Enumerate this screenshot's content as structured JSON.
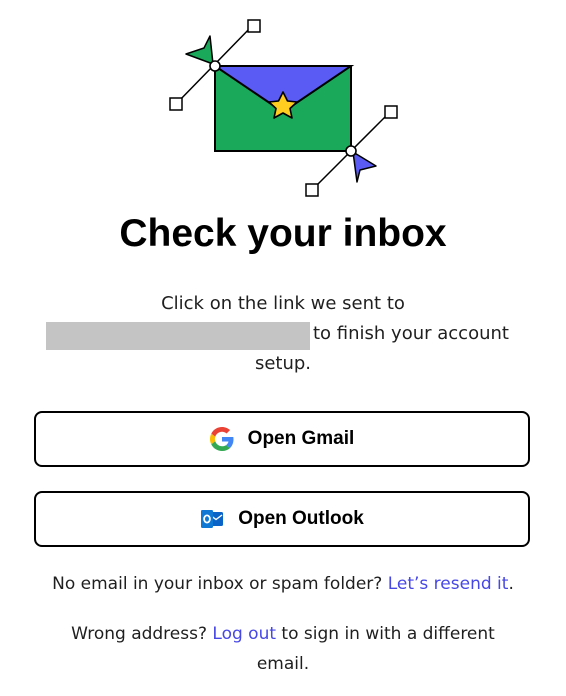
{
  "page": {
    "title": "Check your inbox"
  },
  "message": {
    "line1": "Click on the link we sent to",
    "line2_suffix": "to finish your account",
    "line3": "setup."
  },
  "buttons": {
    "gmail_label": "Open Gmail",
    "outlook_label": "Open Outlook"
  },
  "resend": {
    "prefix": "No email in your inbox or spam folder?",
    "link": "Let’s resend it",
    "suffix": "."
  },
  "wrong_address": {
    "prefix": "Wrong address?",
    "link": "Log out",
    "suffix_line1": "to sign in with a different",
    "suffix_line2": "email."
  },
  "colors": {
    "envelope_green": "#1aa85a",
    "flap_blue": "#5a5af5",
    "star_yellow": "#ffcd1f",
    "link_blue": "#4747e6"
  },
  "icons": {
    "gmail": "google-g-icon",
    "outlook": "outlook-icon"
  }
}
